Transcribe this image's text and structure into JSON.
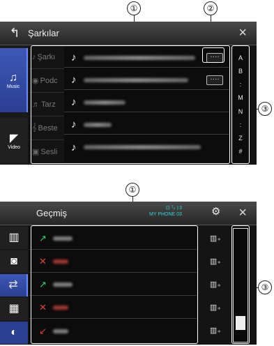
{
  "top": {
    "header": {
      "back_icon": "back-arrow-icon",
      "title": "Şarkılar",
      "close": "×"
    },
    "sidebar": [
      {
        "label": "Music",
        "icon": "music-note-icon",
        "glyph": "♫",
        "active": true
      },
      {
        "label": "Video",
        "icon": "video-clapper-icon",
        "glyph": "🎬",
        "active": false
      }
    ],
    "categories": [
      {
        "label": "Şarkı",
        "glyph": "♪"
      },
      {
        "label": "Podc",
        "glyph": "◉"
      },
      {
        "label": "Tarz",
        "glyph": "♬"
      },
      {
        "label": "Beste",
        "glyph": "𝄞"
      },
      {
        "label": "Sesli",
        "glyph": "▣"
      }
    ],
    "rows": [
      {
        "has_more": true,
        "blur_w": 160
      },
      {
        "has_more": true,
        "blur_w": 150
      },
      {
        "has_more": false,
        "blur_w": 60
      },
      {
        "has_more": false,
        "blur_w": 40
      },
      {
        "has_more": false,
        "blur_w": 168
      }
    ],
    "more_label": "····",
    "az": [
      "A",
      "B",
      ":",
      "M",
      "N",
      ":",
      "Z",
      "#"
    ]
  },
  "bottom": {
    "header": {
      "title": "Geçmiş",
      "status_icons": "⊡ ᵀᵢₗ ᛒ3",
      "device": "MY PHONE 03",
      "settings_icon": "gear-icon",
      "close": "×"
    },
    "sidebar": [
      {
        "icon": "phonebook-icon",
        "glyph": "📖"
      },
      {
        "icon": "contact-card-icon",
        "glyph": "👤"
      },
      {
        "icon": "call-history-icon",
        "glyph": "↶",
        "active": true
      },
      {
        "icon": "keypad-icon",
        "glyph": "⠿"
      },
      {
        "icon": "voice-recognition-icon",
        "glyph": "◐"
      }
    ],
    "calls": [
      {
        "type": "outgoing",
        "glyph": "↗",
        "color": "#2fd46b",
        "blur_color": "#8a8a8a"
      },
      {
        "type": "missed",
        "glyph": "✕",
        "color": "#e0403a",
        "blur_color": "#b03a36"
      },
      {
        "type": "outgoing",
        "glyph": "↗",
        "color": "#2fd46b",
        "blur_color": "#8a8a8a"
      },
      {
        "type": "missed",
        "glyph": "✕",
        "color": "#e0403a",
        "blur_color": "#b03a36"
      },
      {
        "type": "incoming",
        "glyph": "↙",
        "color": "#e0403a",
        "blur_color": "#8a8a8a"
      }
    ],
    "add_icon": "📖₊",
    "scrollbar_position": 0.88
  },
  "callouts": [
    "①",
    "②",
    "③",
    "①",
    "③"
  ]
}
